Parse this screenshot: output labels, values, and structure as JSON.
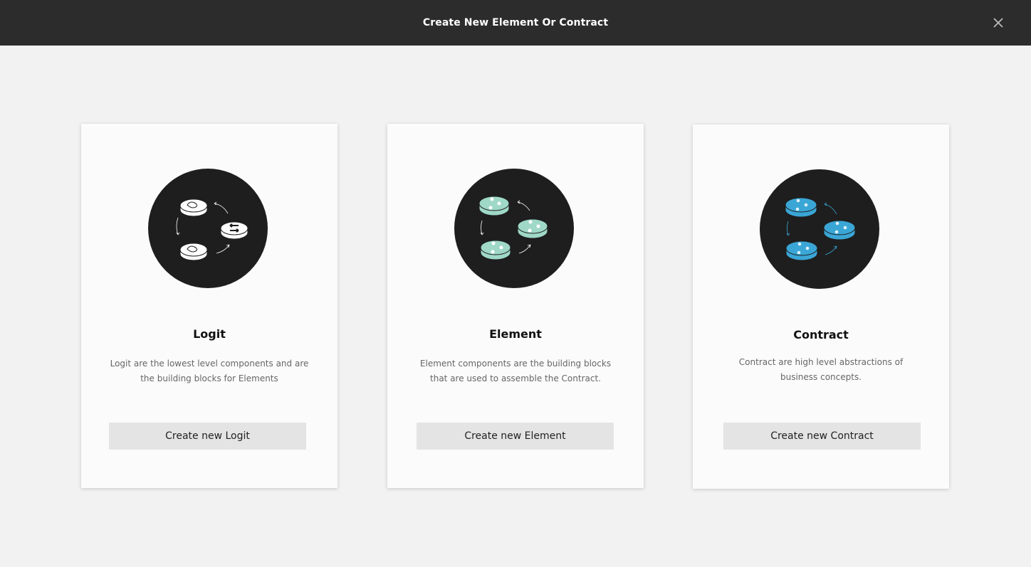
{
  "header": {
    "title": "Create New Element Or Contract",
    "close_icon": "close-icon"
  },
  "colors": {
    "header_bg": "#2c2c2c",
    "logit_accent": "#ffffff",
    "element_accent": "#9fd8c7",
    "contract_accent": "#3aa6d6"
  },
  "cards": [
    {
      "title": "Logit",
      "description": "Logit are the lowest level components and are the building blocks for Elements",
      "button_label": "Create new Logit",
      "icon": "logit-illustration-icon"
    },
    {
      "title": "Element",
      "description": "Element components are the building blocks that are used to assemble the Contract.",
      "button_label": "Create new Element",
      "icon": "element-illustration-icon"
    },
    {
      "title": "Contract",
      "description": "Contract are high level abstractions of business concepts.",
      "button_label": "Create new Contract",
      "icon": "contract-illustration-icon"
    }
  ]
}
